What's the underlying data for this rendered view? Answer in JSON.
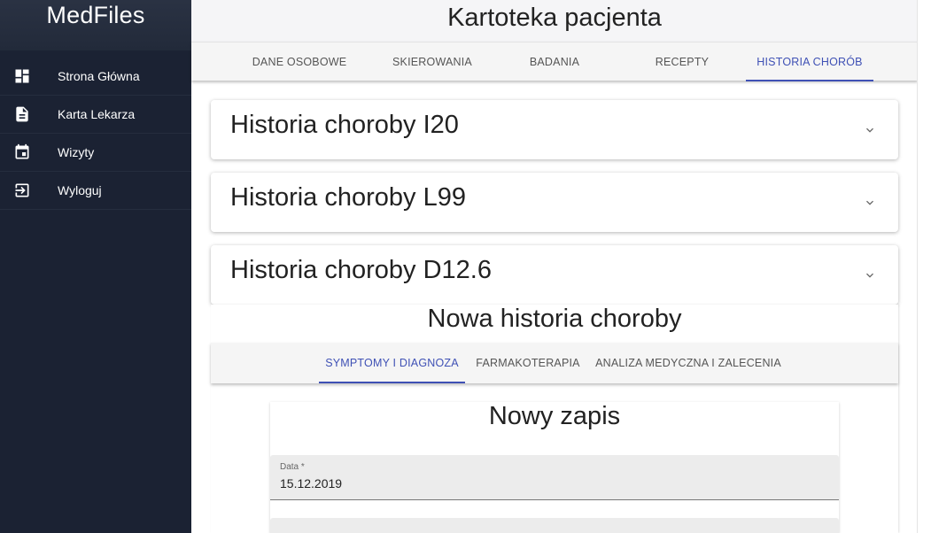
{
  "app": {
    "brand": "MedFiles"
  },
  "sidebar": {
    "items": [
      {
        "label": "Strona Główna",
        "icon": "dashboard-icon"
      },
      {
        "label": "Karta Lekarza",
        "icon": "document-icon"
      },
      {
        "label": "Wizyty",
        "icon": "calendar-icon"
      },
      {
        "label": "Wyloguj",
        "icon": "logout-icon"
      }
    ]
  },
  "header": {
    "title": "Kartoteka pacjenta"
  },
  "tabs": [
    {
      "label": "DANE OSOBOWE",
      "active": false
    },
    {
      "label": "SKIEROWANIA",
      "active": false
    },
    {
      "label": "BADANIA",
      "active": false
    },
    {
      "label": "RECEPTY",
      "active": false
    },
    {
      "label": "HISTORIA CHORÓB",
      "active": true
    }
  ],
  "histories": [
    {
      "title": "Historia choroby I20"
    },
    {
      "title": "Historia choroby L99"
    },
    {
      "title": "Historia choroby D12.6"
    }
  ],
  "new_history": {
    "title": "Nowa historia choroby",
    "tabs": [
      {
        "label": "SYMPTOMY I DIAGNOZA",
        "active": true
      },
      {
        "label": "FARMAKOTERAPIA",
        "active": false
      },
      {
        "label": "ANALIZA MEDYCZNA I ZALECENIA",
        "active": false
      }
    ],
    "card": {
      "title": "Nowy zapis",
      "date_label": "Data *",
      "date_value": "15.12.2019"
    }
  },
  "colors": {
    "accent": "#3f51b5",
    "sidebar_bg": "#1b2233"
  }
}
